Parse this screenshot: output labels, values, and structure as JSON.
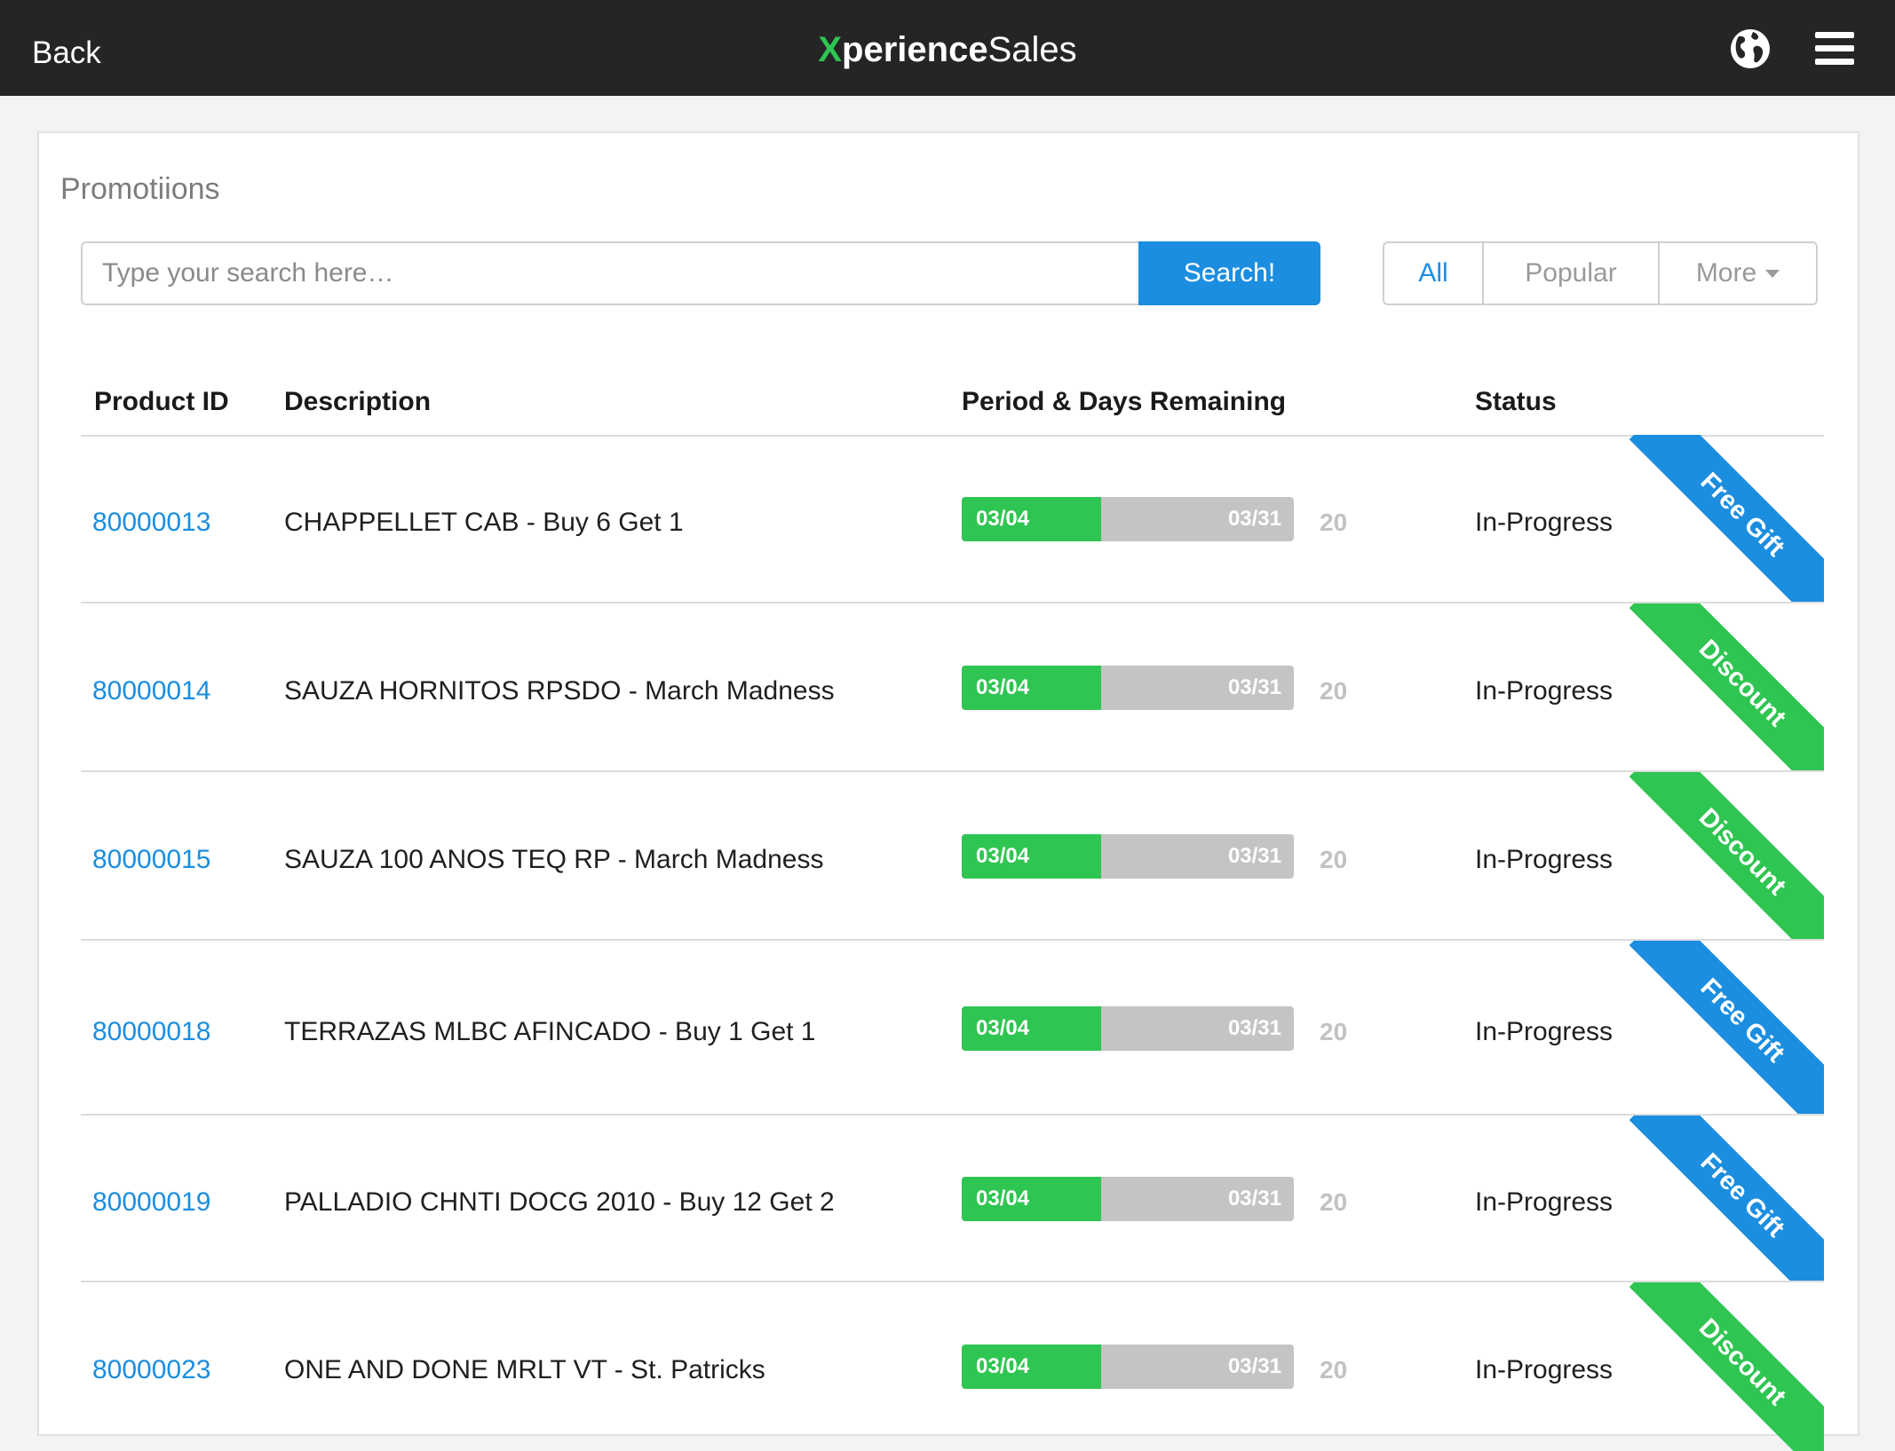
{
  "nav": {
    "back_label": "Back",
    "brand_x": "X",
    "brand_rest": "perience",
    "brand_sales": "Sales"
  },
  "page": {
    "title": "Promotiions"
  },
  "search": {
    "placeholder": "Type your search here…",
    "button_label": "Search!"
  },
  "filters": {
    "all": "All",
    "popular": "Popular",
    "more": "More",
    "selected": "All"
  },
  "table": {
    "headers": {
      "product_id": "Product  ID",
      "description": "Description",
      "period": "Period & Days Remaining",
      "status": "Status"
    },
    "rows": [
      {
        "id": "80000013",
        "description": "CHAPPELLET CAB - Buy 6 Get 1",
        "start": "03/04",
        "end": "03/31",
        "progress": 0.42,
        "days": "20",
        "status": "In-Progress",
        "tag": "Free Gift",
        "tag_color": "#1b8ee0"
      },
      {
        "id": "80000014",
        "description": "SAUZA HORNITOS RPSDO - March Madness",
        "start": "03/04",
        "end": "03/31",
        "progress": 0.42,
        "days": "20",
        "status": "In-Progress",
        "tag": "Discount",
        "tag_color": "#2fc552"
      },
      {
        "id": "80000015",
        "description": "SAUZA 100 ANOS TEQ RP - March Madness",
        "start": "03/04",
        "end": "03/31",
        "progress": 0.42,
        "days": "20",
        "status": "In-Progress",
        "tag": "Discount",
        "tag_color": "#2fc552"
      },
      {
        "id": "80000018",
        "description": "TERRAZAS MLBC AFINCADO - Buy 1 Get 1",
        "start": "03/04",
        "end": "03/31",
        "progress": 0.42,
        "days": "20",
        "status": "In-Progress",
        "tag": "Free Gift",
        "tag_color": "#1b8ee0"
      },
      {
        "id": "80000019",
        "description": "PALLADIO CHNTI DOCG  2010 - Buy 12 Get 2",
        "start": "03/04",
        "end": "03/31",
        "progress": 0.42,
        "days": "20",
        "status": "In-Progress",
        "tag": "Free Gift",
        "tag_color": "#1b8ee0"
      },
      {
        "id": "80000023",
        "description": "ONE AND DONE MRLT  VT - St. Patricks",
        "start": "03/04",
        "end": "03/31",
        "progress": 0.42,
        "days": "20",
        "status": "In-Progress",
        "tag": "Discount",
        "tag_color": "#2fc552"
      }
    ]
  },
  "colors": {
    "accent": "#1b8ee0",
    "green": "#2fc552",
    "topbar": "#252525"
  }
}
